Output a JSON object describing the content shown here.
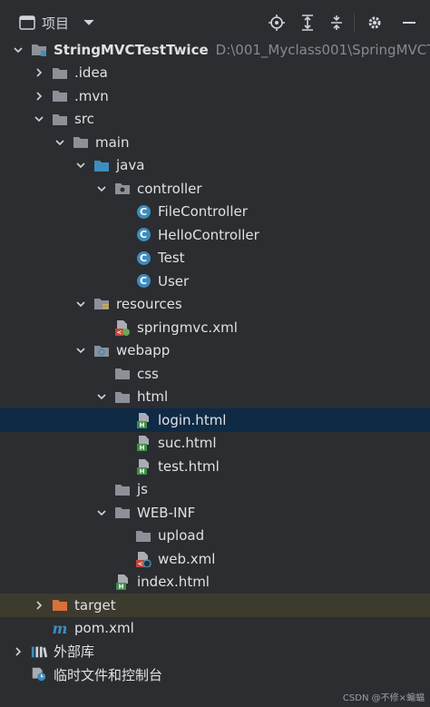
{
  "header": {
    "title": "项目",
    "dropdown_icon": "chevron-down-icon",
    "actions": [
      "locate-icon",
      "expand-all-icon",
      "collapse-all-icon",
      "gear-icon",
      "minimize-icon"
    ]
  },
  "tree": [
    {
      "label": "StringMVCTestTwice",
      "path": "D:\\001_Myclass001\\SpringMVCT",
      "icon": "module-folder-icon",
      "expanded": true
    },
    {
      "label": ".idea",
      "icon": "folder-icon",
      "expanded": false
    },
    {
      "label": ".mvn",
      "icon": "folder-icon",
      "expanded": false
    },
    {
      "label": "src",
      "icon": "folder-icon",
      "expanded": true
    },
    {
      "label": "main",
      "icon": "folder-icon",
      "expanded": true
    },
    {
      "label": "java",
      "icon": "source-folder-icon",
      "expanded": true
    },
    {
      "label": "controller",
      "icon": "package-icon",
      "expanded": true
    },
    {
      "label": "FileController",
      "icon": "class-icon"
    },
    {
      "label": "HelloController",
      "icon": "class-icon"
    },
    {
      "label": "Test",
      "icon": "class-icon"
    },
    {
      "label": "User",
      "icon": "class-icon"
    },
    {
      "label": "resources",
      "icon": "resources-folder-icon",
      "expanded": true
    },
    {
      "label": "springmvc.xml",
      "icon": "spring-xml-icon"
    },
    {
      "label": "webapp",
      "icon": "web-folder-icon",
      "expanded": true
    },
    {
      "label": "css",
      "icon": "folder-icon"
    },
    {
      "label": "html",
      "icon": "folder-icon",
      "expanded": true
    },
    {
      "label": "login.html",
      "icon": "html-file-icon",
      "selected": true
    },
    {
      "label": "suc.html",
      "icon": "html-file-icon"
    },
    {
      "label": "test.html",
      "icon": "html-file-icon"
    },
    {
      "label": "js",
      "icon": "folder-icon"
    },
    {
      "label": "WEB-INF",
      "icon": "folder-icon",
      "expanded": true
    },
    {
      "label": "upload",
      "icon": "folder-icon"
    },
    {
      "label": "web.xml",
      "icon": "web-xml-icon"
    },
    {
      "label": "index.html",
      "icon": "html-file-icon"
    },
    {
      "label": "target",
      "icon": "excluded-folder-icon",
      "expanded": false,
      "highlighted": true
    },
    {
      "label": "pom.xml",
      "icon": "maven-icon"
    },
    {
      "label": "外部库",
      "icon": "libraries-icon",
      "expanded": false
    },
    {
      "label": "临时文件和控制台",
      "icon": "scratches-icon"
    }
  ],
  "watermark": "CSDN @不修×蝙蝠",
  "colors": {
    "background": "#2b2d30",
    "selection": "#0e2a45",
    "highlight": "#3d3a2e",
    "folder": "#8c9199",
    "source_folder": "#3d8dbd",
    "excluded_folder": "#d9703a",
    "class_icon": "#3d8dbd",
    "html_badge": "#3e8f47"
  }
}
